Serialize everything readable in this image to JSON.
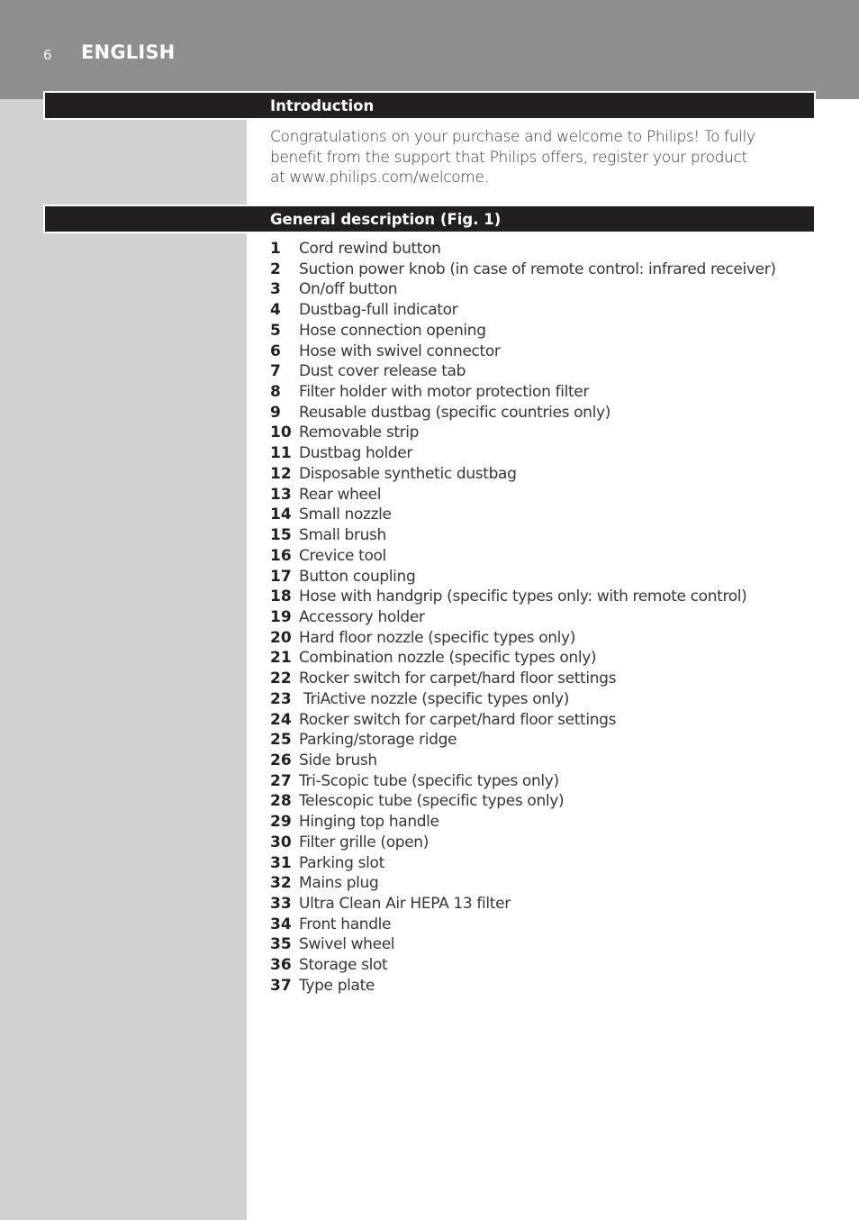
{
  "header": {
    "page_number": "6",
    "language": "ENGLISH"
  },
  "sections": {
    "introduction": {
      "title": "Introduction",
      "lines": [
        "Congratulations on your purchase and welcome to Philips! To fully",
        "benefit from the support that Philips offers, register your product",
        "at www.philips.com/welcome."
      ]
    },
    "general_description": {
      "title": "General description (Fig. 1)",
      "items": [
        {
          "num": "1",
          "text": "Cord rewind button"
        },
        {
          "num": "2",
          "text": "Suction power knob (in case of remote control: infrared receiver)"
        },
        {
          "num": "3",
          "text": "On/off button"
        },
        {
          "num": "4",
          "text": "Dustbag-full indicator"
        },
        {
          "num": "5",
          "text": "Hose connection opening"
        },
        {
          "num": "6",
          "text": "Hose with swivel connector"
        },
        {
          "num": "7",
          "text": "Dust cover release tab"
        },
        {
          "num": "8",
          "text": "Filter holder with motor protection filter"
        },
        {
          "num": "9",
          "text": "Reusable dustbag (specific countries only)"
        },
        {
          "num": "10",
          "text": "Removable strip"
        },
        {
          "num": "11",
          "text": "Dustbag holder"
        },
        {
          "num": "12",
          "text": "Disposable synthetic dustbag"
        },
        {
          "num": "13",
          "text": "Rear wheel"
        },
        {
          "num": "14",
          "text": "Small nozzle"
        },
        {
          "num": "15",
          "text": "Small brush"
        },
        {
          "num": "16",
          "text": "Crevice tool"
        },
        {
          "num": "17",
          "text": "Button coupling"
        },
        {
          "num": "18",
          "text": "Hose with handgrip (specific types only: with remote control)"
        },
        {
          "num": "19",
          "text": "Accessory holder"
        },
        {
          "num": "20",
          "text": "Hard floor nozzle (specific types only)"
        },
        {
          "num": "21",
          "text": "Combination nozzle (specific types only)"
        },
        {
          "num": "22",
          "text": "Rocker switch for carpet/hard floor settings"
        },
        {
          "num": "23",
          "text": " TriActive nozzle (specific types only)"
        },
        {
          "num": "24",
          "text": "Rocker switch for carpet/hard floor settings"
        },
        {
          "num": "25",
          "text": "Parking/storage ridge"
        },
        {
          "num": "26",
          "text": "Side brush"
        },
        {
          "num": "27",
          "text": "Tri-Scopic tube (specific types only)"
        },
        {
          "num": "28",
          "text": "Telescopic tube (specific types only)"
        },
        {
          "num": "29",
          "text": "Hinging top handle"
        },
        {
          "num": "30",
          "text": "Filter grille (open)"
        },
        {
          "num": "31",
          "text": "Parking slot"
        },
        {
          "num": "32",
          "text": "Mains plug"
        },
        {
          "num": "33",
          "text": "Ultra Clean Air HEPA 13 filter"
        },
        {
          "num": "34",
          "text": "Front handle"
        },
        {
          "num": "35",
          "text": "Swivel wheel"
        },
        {
          "num": "36",
          "text": "Storage slot"
        },
        {
          "num": "37",
          "text": "Type plate"
        }
      ]
    }
  },
  "colors": {
    "header_band": "#8f8d8e",
    "side_column": "#d1d1d1",
    "section_bar": "#231f20",
    "body_text": "#3a3536"
  }
}
